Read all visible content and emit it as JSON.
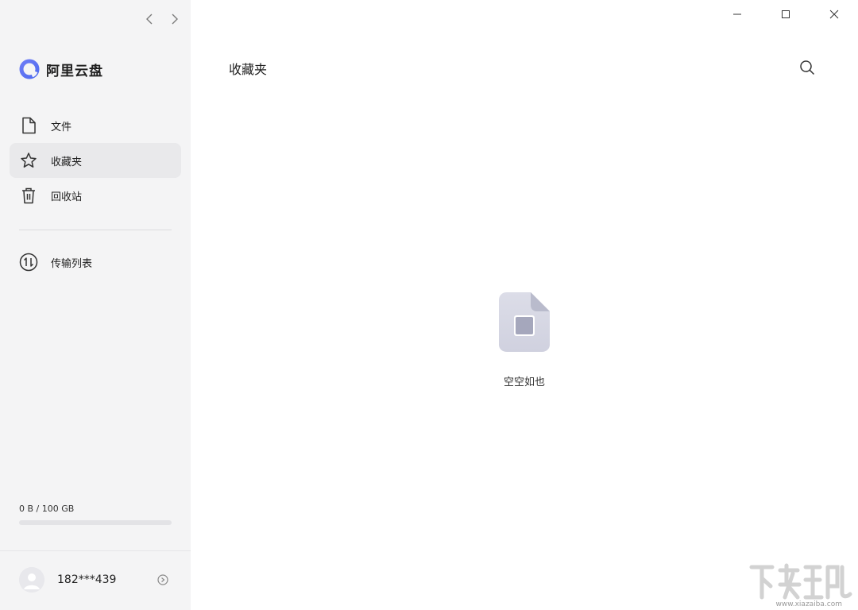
{
  "app": {
    "name": "阿里云盘"
  },
  "sidebar": {
    "items": [
      {
        "label": "文件",
        "icon": "file-icon",
        "active": false
      },
      {
        "label": "收藏夹",
        "icon": "star-icon",
        "active": true
      },
      {
        "label": "回收站",
        "icon": "trash-icon",
        "active": false
      }
    ],
    "transfer": {
      "label": "传输列表",
      "icon": "transfer-icon"
    },
    "storage": {
      "text": "0 B / 100 GB",
      "used_fraction": 0
    },
    "user": {
      "name": "182***439"
    }
  },
  "main": {
    "title": "收藏夹",
    "empty_text": "空空如也"
  },
  "watermark": {
    "url": "www.xiazaiba.com"
  },
  "colors": {
    "accent": "#637dff",
    "sidebar_bg": "#f4f4f5",
    "active_bg": "#e9e9eb"
  }
}
